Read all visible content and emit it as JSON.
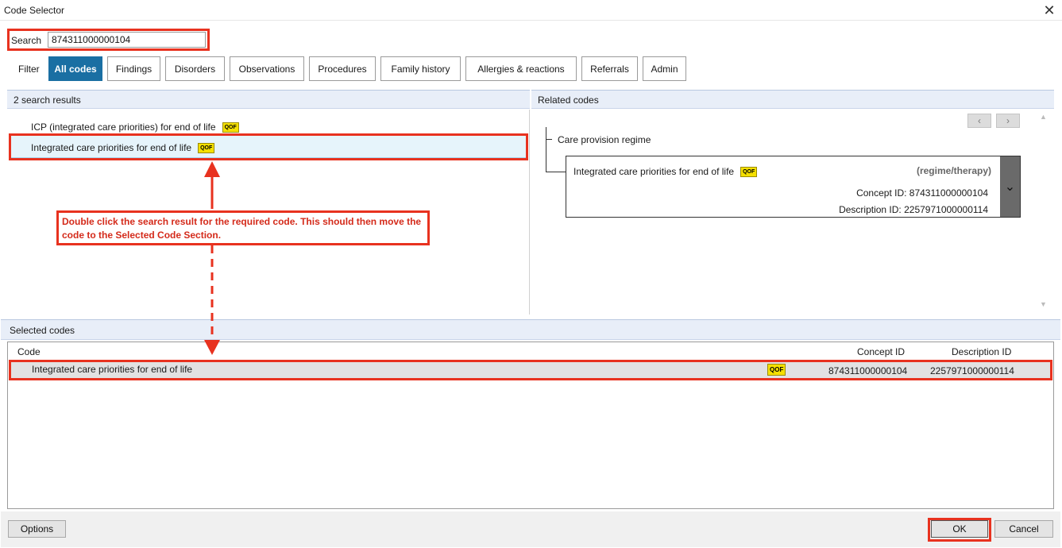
{
  "window": {
    "title": "Code Selector",
    "close_glyph": "✕"
  },
  "search": {
    "label": "Search",
    "value": "874311000000104"
  },
  "filter": {
    "label": "Filter",
    "tabs": [
      {
        "label": "All codes",
        "active": true
      },
      {
        "label": "Findings"
      },
      {
        "label": "Disorders"
      },
      {
        "label": "Observations"
      },
      {
        "label": "Procedures"
      },
      {
        "label": "Family history"
      },
      {
        "label": "Allergies & reactions"
      },
      {
        "label": "Referrals"
      },
      {
        "label": "Admin"
      }
    ]
  },
  "results": {
    "header": "2 search results",
    "items": [
      {
        "label": "ICP (integrated care priorities) for end of life",
        "badge": "QOF"
      },
      {
        "label": "Integrated care priorities for end of life",
        "badge": "QOF"
      }
    ]
  },
  "annotation": {
    "text": "Double click the search result for the required code. This should then move the code to the Selected Code Section."
  },
  "related": {
    "header": "Related codes",
    "prev_glyph": "‹",
    "next_glyph": "›",
    "parent": "Care provision regime",
    "card": {
      "title": "Integrated care priorities for end of life",
      "badge": "QOF",
      "semantic_tag": "(regime/therapy)",
      "concept_id": "Concept ID: 874311000000104",
      "description_id": "Description ID: 2257971000000114",
      "expand_glyph": "⌄"
    }
  },
  "selected": {
    "header": "Selected codes",
    "columns": {
      "code": "Code",
      "concept_id": "Concept ID",
      "description_id": "Description ID"
    },
    "rows": [
      {
        "code": "Integrated care priorities for end of life",
        "badge": "QOF",
        "concept_id": "874311000000104",
        "description_id": "2257971000000114"
      }
    ]
  },
  "buttons": {
    "options": "Options",
    "ok": "OK",
    "cancel": "Cancel"
  },
  "colors": {
    "accent": "#1a6fa3",
    "highlight_red": "#e8321f",
    "qof_yellow": "#f5e000"
  }
}
